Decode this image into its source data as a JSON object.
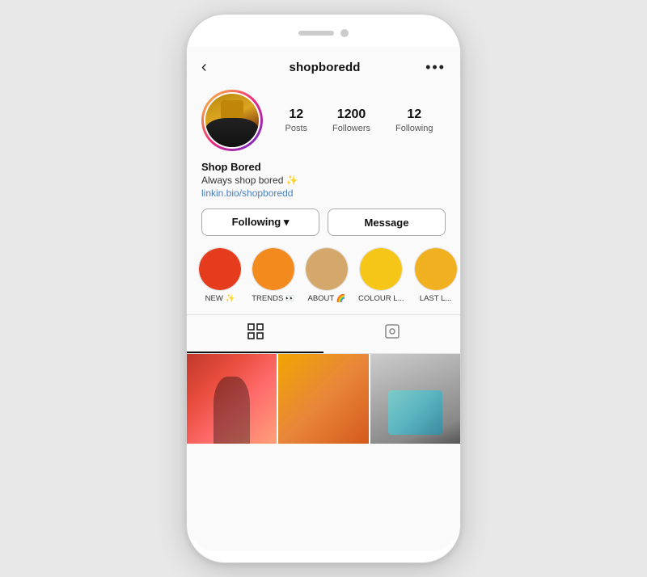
{
  "phone": {
    "header": {
      "title": "shopboredd",
      "back_label": "‹",
      "more_label": "•••"
    },
    "profile": {
      "posts_count": "12",
      "posts_label": "Posts",
      "followers_count": "1200",
      "followers_label": "Followers",
      "following_count": "12",
      "following_label": "Following"
    },
    "bio": {
      "name": "Shop Bored",
      "tagline": "Always shop bored ✨",
      "link": "linkin.bio/shopboredd"
    },
    "buttons": {
      "following_label": "Following ▾",
      "message_label": "Message"
    },
    "highlights": [
      {
        "label": "NEW ✨",
        "color": "red"
      },
      {
        "label": "TRENDS 👀",
        "color": "orange"
      },
      {
        "label": "ABOUT 🌈",
        "color": "tan"
      },
      {
        "label": "COLOUR L...",
        "color": "yellow"
      },
      {
        "label": "LAST L...",
        "color": "yellow2"
      }
    ],
    "tabs": [
      {
        "id": "grid",
        "icon": "⊞",
        "active": true
      },
      {
        "id": "tagged",
        "icon": "◻",
        "active": false
      }
    ]
  }
}
